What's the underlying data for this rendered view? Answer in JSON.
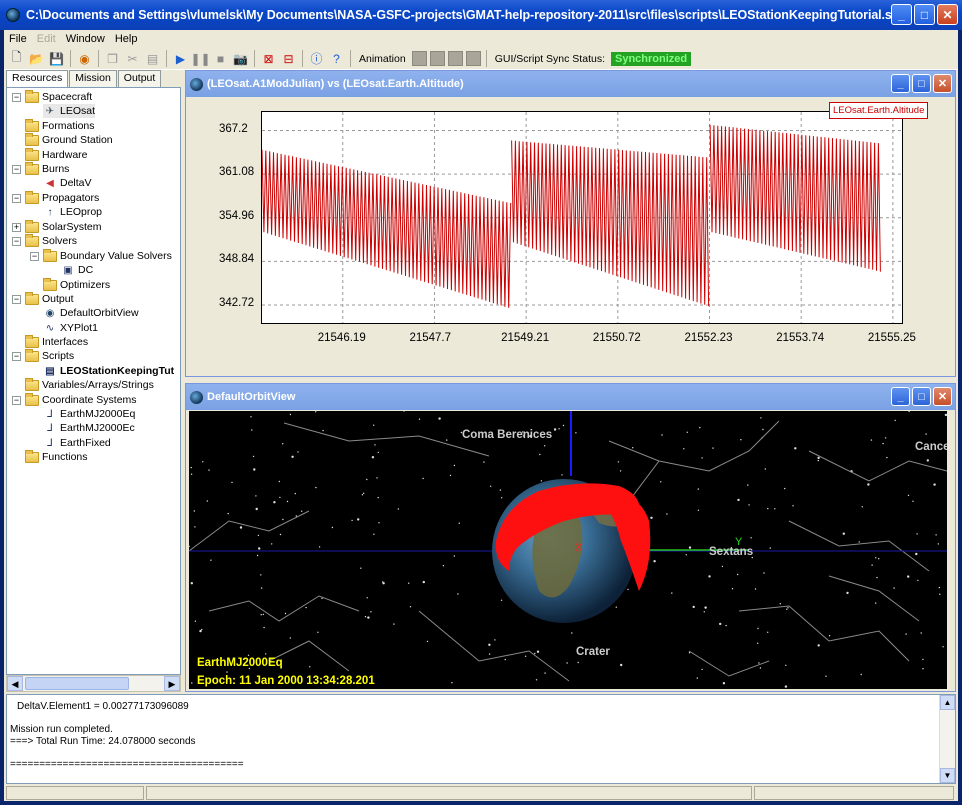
{
  "window": {
    "title": "C:\\Documents and Settings\\vlumelsk\\My Documents\\NASA-GSFC-projects\\GMAT-help-repository-2011\\src\\files\\scripts\\LEOStationKeepingTutorial.script - ..."
  },
  "menu": {
    "file": "File",
    "edit": "Edit",
    "window": "Window",
    "help": "Help"
  },
  "toolbar": {
    "animation_label": "Animation",
    "sync_label": "GUI/Script Sync Status:",
    "sync_status": "Synchronized",
    "sync_color": "#24a224"
  },
  "tabs": {
    "resources": "Resources",
    "mission": "Mission",
    "output": "Output"
  },
  "tree": {
    "spacecraft": "Spacecraft",
    "leosat": "LEOsat",
    "formations": "Formations",
    "ground_station": "Ground Station",
    "hardware": "Hardware",
    "burns": "Burns",
    "deltav": "DeltaV",
    "propagators": "Propagators",
    "leoprop": "LEOprop",
    "solar_system": "SolarSystem",
    "solvers": "Solvers",
    "boundary_value_solvers": "Boundary Value Solvers",
    "dc": "DC",
    "optimizers": "Optimizers",
    "output": "Output",
    "default_orbit_view": "DefaultOrbitView",
    "xyplot1": "XYPlot1",
    "interfaces": "Interfaces",
    "scripts": "Scripts",
    "script_file": "LEOStationKeepingTut",
    "variables": "Variables/Arrays/Strings",
    "coordinate_systems": "Coordinate Systems",
    "earthmj2000eq": "EarthMJ2000Eq",
    "earthmj2000ec": "EarthMJ2000Ec",
    "earthfixed": "EarthFixed",
    "functions": "Functions"
  },
  "plot_window": {
    "title": "(LEOsat.A1ModJulian) vs (LEOsat.Earth.Altitude)",
    "legend": "LEOsat.Earth.Altitude",
    "series_color": "#cc0000"
  },
  "chart_data": {
    "type": "line",
    "xlabel": "",
    "ylabel": "",
    "x_ticks": [
      "21546.19",
      "21547.7",
      "21549.21",
      "21550.72",
      "21552.23",
      "21553.74",
      "21555.25"
    ],
    "y_ticks": [
      "367.2",
      "361.08",
      "354.96",
      "348.84",
      "342.72"
    ],
    "xlim": [
      21544.86,
      21555.4
    ],
    "ylim": [
      340.2,
      369.8
    ],
    "grid": true,
    "legend_position": "top-right",
    "series": [
      {
        "name": "LEOsat.Earth.Altitude",
        "segments": [
          {
            "x_start": 21544.86,
            "x_end": 21548.97,
            "upper_start": 364.5,
            "upper_end": 357.0,
            "lower_start": 353.0,
            "lower_end": 342.2
          },
          {
            "x_start": 21548.97,
            "x_end": 21552.24,
            "upper_start": 365.8,
            "upper_end": 363.4,
            "lower_start": 351.6,
            "lower_end": 342.5
          },
          {
            "x_start": 21552.24,
            "x_end": 21555.05,
            "upper_start": 368.0,
            "upper_end": 365.4,
            "lower_start": 353.0,
            "lower_end": 347.4
          }
        ],
        "oscillation_period_days": 0.063
      }
    ]
  },
  "orbit_window": {
    "title": "DefaultOrbitView",
    "labels": {
      "coma": "Coma Berenices",
      "cancer": "Cancer",
      "sextans": "Sextans",
      "crater": "Crater",
      "x_axis": "X",
      "y_axis": "Y"
    },
    "coordinate_system": "EarthMJ2000Eq",
    "epoch": "Epoch: 11 Jan 2000 13:34:28.201"
  },
  "console": {
    "line1": "DeltaV.Element1 = 0.00277173096089",
    "line2": "Mission run completed.",
    "line3": "===> Total Run Time: 24.078000 seconds",
    "line4": "========================================"
  }
}
